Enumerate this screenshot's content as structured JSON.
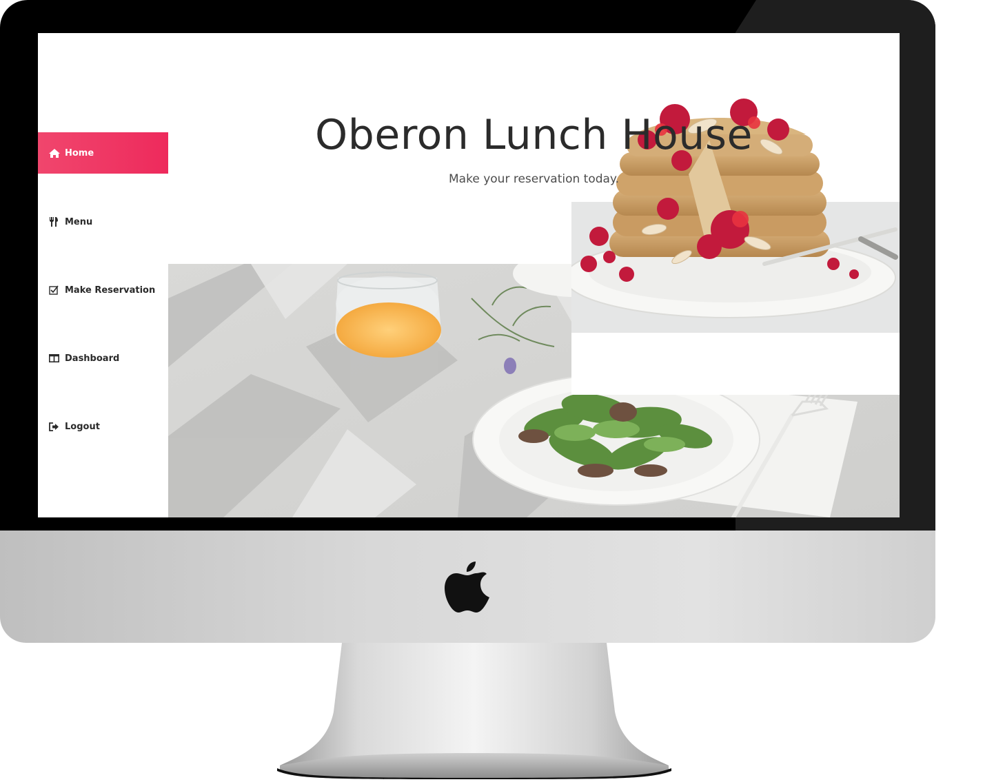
{
  "app": {
    "title": "Oberon Lunch House",
    "subtitle": "Make your reservation today."
  },
  "sidebar": {
    "items": [
      {
        "label": "Home",
        "icon": "home-icon",
        "active": true
      },
      {
        "label": "Menu",
        "icon": "cutlery-icon",
        "active": false
      },
      {
        "label": "Make Reservation",
        "icon": "checkbox-icon",
        "active": false
      },
      {
        "label": "Dashboard",
        "icon": "dashboard-icon",
        "active": false
      },
      {
        "label": "Logout",
        "icon": "logout-icon",
        "active": false
      }
    ]
  },
  "colors": {
    "accent": "#ee2a5c",
    "bezel": "#000000",
    "chin": "#d8d8d8"
  }
}
